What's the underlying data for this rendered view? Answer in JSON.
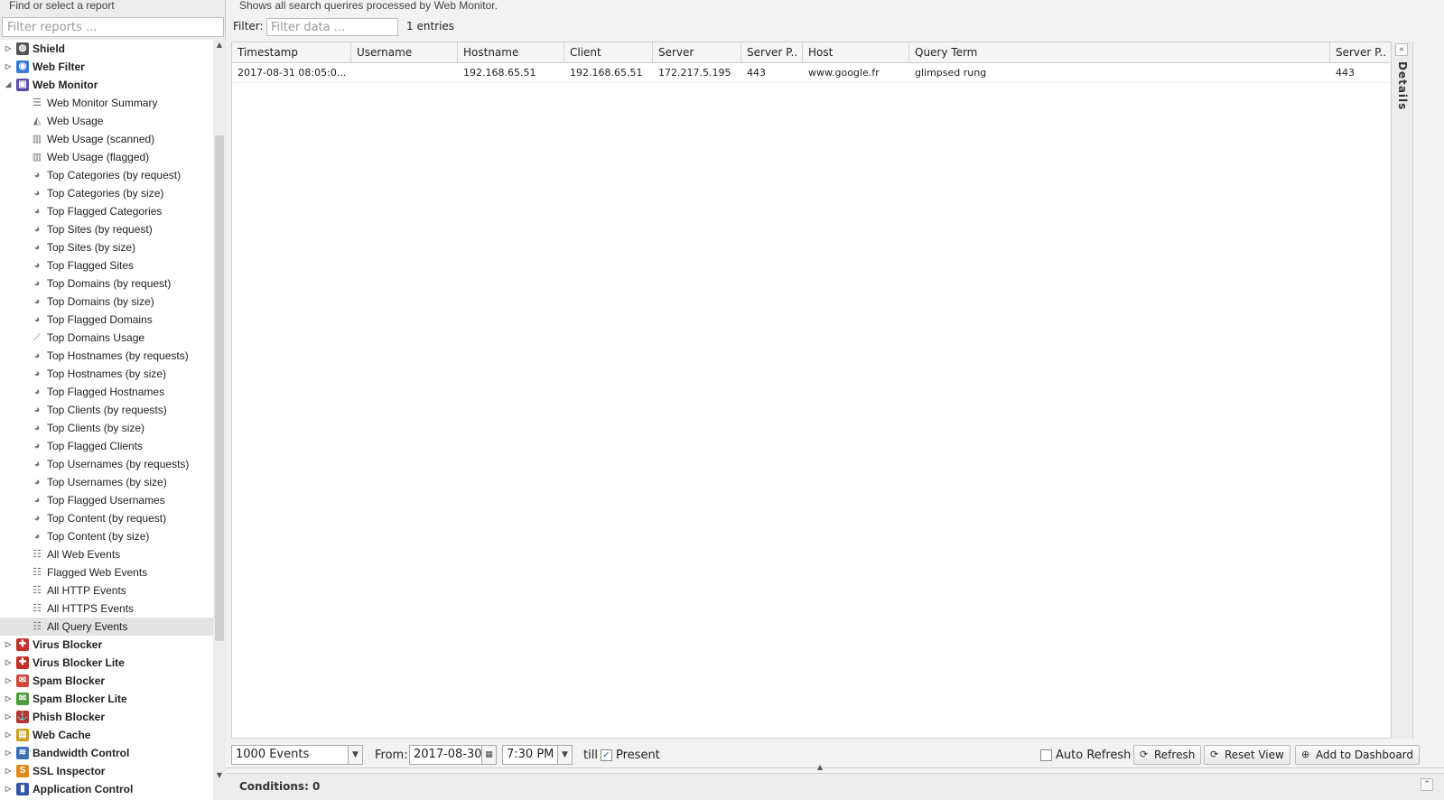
{
  "left": {
    "hint": "Find or select a report",
    "filter_placeholder": "Filter reports ...",
    "groups_top": [
      {
        "label": "Shield",
        "icon": "shield-icon",
        "color": "#555555",
        "glyph": "◍"
      },
      {
        "label": "Web Filter",
        "icon": "web-filter-icon",
        "color": "#3a7bd5",
        "glyph": "◉"
      }
    ],
    "open_group": {
      "label": "Web Monitor",
      "icon": "web-monitor-icon",
      "color": "#5b4fa8",
      "glyph": "▣"
    },
    "children": [
      {
        "label": "Web Monitor Summary",
        "icon": "summary-icon",
        "glyph": "☰"
      },
      {
        "label": "Web Usage",
        "icon": "area-chart-icon",
        "glyph": "◭"
      },
      {
        "label": "Web Usage (scanned)",
        "icon": "bar-chart-icon",
        "glyph": "▥"
      },
      {
        "label": "Web Usage (flagged)",
        "icon": "bar-chart-icon",
        "glyph": "▥"
      },
      {
        "label": "Top Categories (by request)",
        "icon": "pie-chart-icon",
        "glyph": "◕"
      },
      {
        "label": "Top Categories (by size)",
        "icon": "pie-chart-icon",
        "glyph": "◕"
      },
      {
        "label": "Top Flagged Categories",
        "icon": "pie-chart-icon",
        "glyph": "◕"
      },
      {
        "label": "Top Sites (by request)",
        "icon": "pie-chart-icon",
        "glyph": "◕"
      },
      {
        "label": "Top Sites (by size)",
        "icon": "pie-chart-icon",
        "glyph": "◕"
      },
      {
        "label": "Top Flagged Sites",
        "icon": "pie-chart-icon",
        "glyph": "◕"
      },
      {
        "label": "Top Domains (by request)",
        "icon": "pie-chart-icon",
        "glyph": "◕"
      },
      {
        "label": "Top Domains (by size)",
        "icon": "pie-chart-icon",
        "glyph": "◕"
      },
      {
        "label": "Top Flagged Domains",
        "icon": "pie-chart-icon",
        "glyph": "◕"
      },
      {
        "label": "Top Domains Usage",
        "icon": "line-chart-icon",
        "glyph": "⟋"
      },
      {
        "label": "Top Hostnames (by requests)",
        "icon": "pie-chart-icon",
        "glyph": "◕"
      },
      {
        "label": "Top Hostnames (by size)",
        "icon": "pie-chart-icon",
        "glyph": "◕"
      },
      {
        "label": "Top Flagged Hostnames",
        "icon": "pie-chart-icon",
        "glyph": "◕"
      },
      {
        "label": "Top Clients (by requests)",
        "icon": "pie-chart-icon",
        "glyph": "◕"
      },
      {
        "label": "Top Clients (by size)",
        "icon": "pie-chart-icon",
        "glyph": "◕"
      },
      {
        "label": "Top Flagged Clients",
        "icon": "pie-chart-icon",
        "glyph": "◕"
      },
      {
        "label": "Top Usernames (by requests)",
        "icon": "pie-chart-icon",
        "glyph": "◕"
      },
      {
        "label": "Top Usernames (by size)",
        "icon": "pie-chart-icon",
        "glyph": "◕"
      },
      {
        "label": "Top Flagged Usernames",
        "icon": "pie-chart-icon",
        "glyph": "◕"
      },
      {
        "label": "Top Content (by request)",
        "icon": "pie-chart-icon",
        "glyph": "◕"
      },
      {
        "label": "Top Content (by size)",
        "icon": "pie-chart-icon",
        "glyph": "◕"
      },
      {
        "label": "All Web Events",
        "icon": "list-icon",
        "glyph": "☷"
      },
      {
        "label": "Flagged Web Events",
        "icon": "list-icon",
        "glyph": "☷"
      },
      {
        "label": "All HTTP Events",
        "icon": "list-icon",
        "glyph": "☷"
      },
      {
        "label": "All HTTPS Events",
        "icon": "list-icon",
        "glyph": "☷"
      },
      {
        "label": "All Query Events",
        "icon": "list-icon",
        "glyph": "☷",
        "selected": true
      }
    ],
    "groups_bottom": [
      {
        "label": "Virus Blocker",
        "icon": "virus-blocker-icon",
        "color": "#c0312b",
        "glyph": "✚"
      },
      {
        "label": "Virus Blocker Lite",
        "icon": "virus-blocker-lite-icon",
        "color": "#c0312b",
        "glyph": "✚"
      },
      {
        "label": "Spam Blocker",
        "icon": "spam-blocker-icon",
        "color": "#d0483a",
        "glyph": "✉"
      },
      {
        "label": "Spam Blocker Lite",
        "icon": "spam-blocker-lite-icon",
        "color": "#4a9b3a",
        "glyph": "✉"
      },
      {
        "label": "Phish Blocker",
        "icon": "phish-blocker-icon",
        "color": "#b5342c",
        "glyph": "⚓"
      },
      {
        "label": "Web Cache",
        "icon": "web-cache-icon",
        "color": "#c99a1f",
        "glyph": "▤"
      },
      {
        "label": "Bandwidth Control",
        "icon": "bandwidth-control-icon",
        "color": "#3a6fb5",
        "glyph": "≋"
      },
      {
        "label": "SSL Inspector",
        "icon": "ssl-inspector-icon",
        "color": "#e08a1e",
        "glyph": "S"
      },
      {
        "label": "Application Control",
        "icon": "application-control-icon",
        "color": "#3556a8",
        "glyph": "▮"
      }
    ]
  },
  "main": {
    "description": "Shows all search querires processed by Web Monitor.",
    "filter_label": "Filter:",
    "filter_placeholder": "Filter data ...",
    "entries": "1 entries",
    "columns": [
      "Timestamp",
      "Username",
      "Hostname",
      "Client",
      "Server",
      "Server P..",
      "Host",
      "Query Term",
      "Server P.."
    ],
    "rows": [
      [
        "2017-08-31 08:05:0...",
        "",
        "192.168.65.51",
        "192.168.65.51",
        "172.217.5.195",
        "443",
        "www.google.fr",
        "glimpsed rung",
        "443"
      ]
    ],
    "details_label": "Details"
  },
  "toolbar": {
    "events_select": "1000 Events",
    "from_label": "From:",
    "from_date": "2017-08-30",
    "from_time": "7:30 PM",
    "till_label": "till",
    "present_label": "Present",
    "present_checked": true,
    "auto_refresh_label": "Auto Refresh",
    "auto_refresh_checked": false,
    "refresh_label": "Refresh",
    "reset_view_label": "Reset View",
    "add_dashboard_label": "Add to Dashboard"
  },
  "conditions": {
    "label": "Conditions: 0"
  }
}
